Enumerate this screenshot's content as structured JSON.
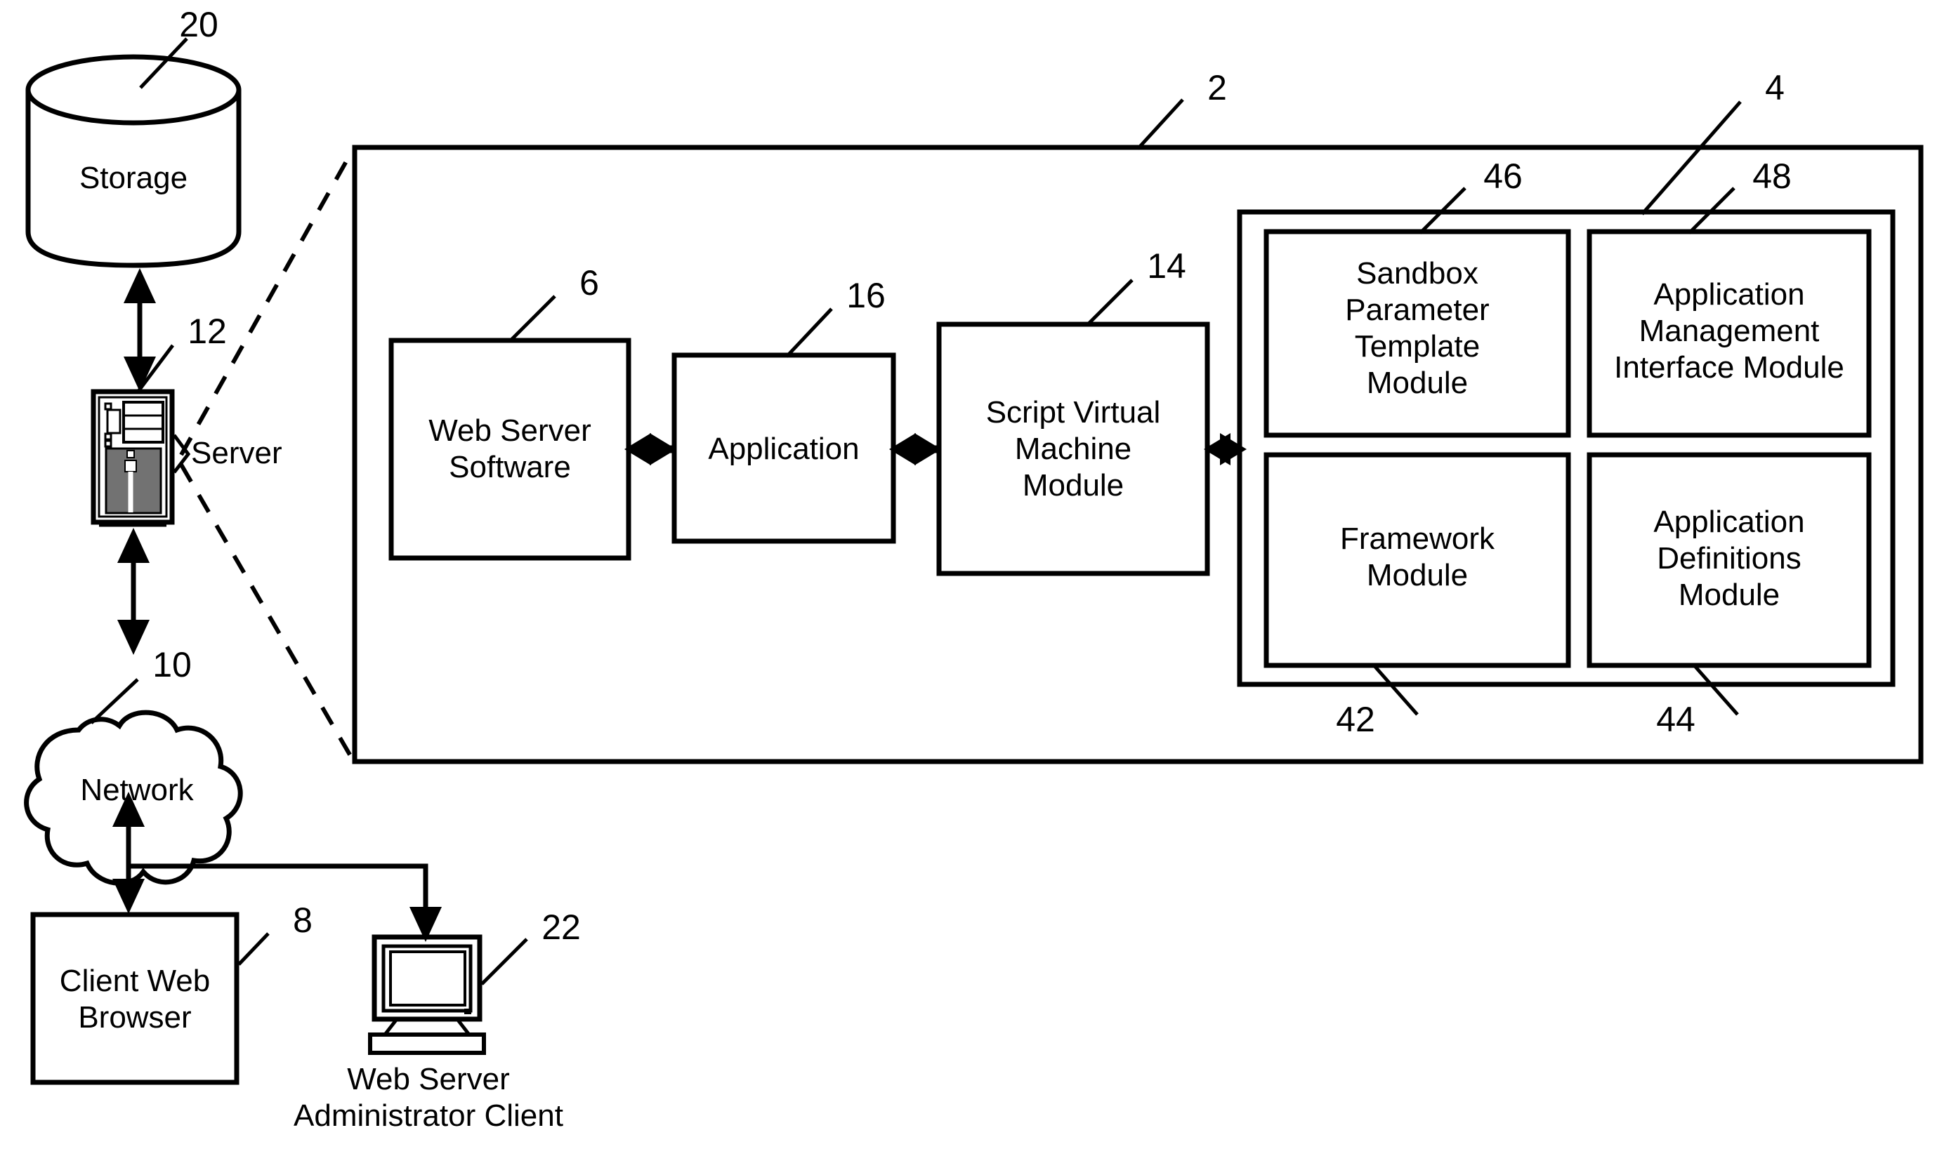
{
  "figure": {
    "type": "patent-block-diagram",
    "background": "#ffffff",
    "stroke": "#000000"
  },
  "nodes": {
    "storage": {
      "label": "Storage",
      "ref": "20"
    },
    "server": {
      "label": "Server",
      "ref": "12"
    },
    "network": {
      "label": "Network",
      "ref": "10"
    },
    "client_browser": {
      "label": "Client Web\nBrowser",
      "ref": "8"
    },
    "admin_client": {
      "caption": "Web Server\nAdministrator Client",
      "ref": "22"
    }
  },
  "server_box": {
    "ref": "2",
    "blocks": {
      "web_server_software": {
        "label": "Web Server\nSoftware",
        "ref": "6"
      },
      "application": {
        "label": "Application",
        "ref": "16"
      },
      "script_vm": {
        "label": "Script Virtual\nMachine\nModule",
        "ref": "14"
      }
    },
    "module_container": {
      "ref": "4",
      "modules": [
        {
          "label": "Sandbox\nParameter\nTemplate\nModule",
          "ref": "46"
        },
        {
          "label": "Application\nManagement\nInterface Module",
          "ref": "48"
        },
        {
          "label": "Framework\nModule",
          "ref": "42"
        },
        {
          "label": "Application\nDefinitions\nModule",
          "ref": "44"
        }
      ]
    }
  }
}
